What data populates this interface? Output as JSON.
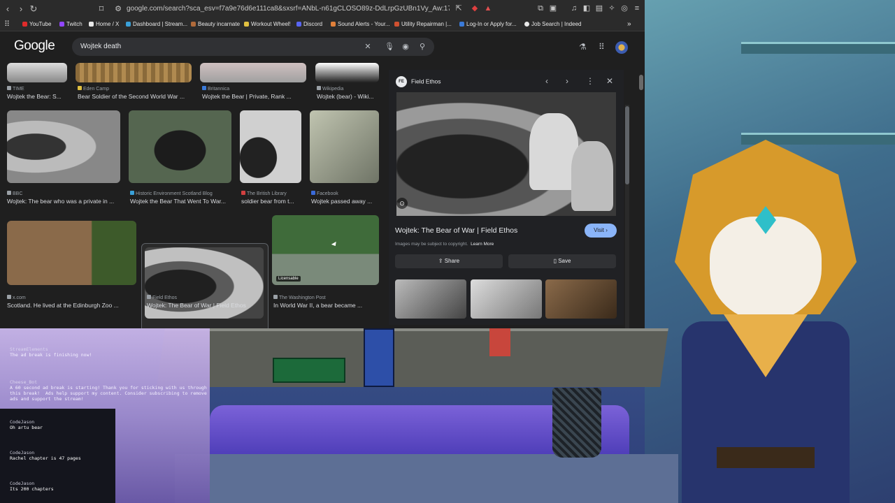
{
  "browser": {
    "url": "google.com/search?sca_esv=f7a9e76d6e111ca8&sxsrf=ANbL-n61gCLOSO89z-DdLrpGzUBn1Vy_Aw:1773295222080&udm...",
    "bookmarks": [
      {
        "label": "YouTube",
        "color": "#e02b2b"
      },
      {
        "label": "Twitch",
        "color": "#9146ff"
      },
      {
        "label": "Home / X",
        "color": "#e8e8e8"
      },
      {
        "label": "Dashboard | Stream...",
        "color": "#3aa0d8"
      },
      {
        "label": "Beauty incarnate",
        "color": "#b06a3a"
      },
      {
        "label": "Workout Wheel!",
        "color": "#e0c040"
      },
      {
        "label": "Discord",
        "color": "#5865f2"
      },
      {
        "label": "Sound Alerts - Your...",
        "color": "#e0803a"
      },
      {
        "label": "Utility Repairman |...",
        "color": "#d05030"
      },
      {
        "label": "Log-In or Apply for...",
        "color": "#3a7ad8"
      },
      {
        "label": "Job Search | Indeed",
        "color": "#e8e8e8"
      }
    ]
  },
  "google": {
    "logo": "Google",
    "query": "Wojtek death"
  },
  "results": {
    "row1": [
      {
        "source": "TIME",
        "title": "Wojtek the Bear: S..."
      },
      {
        "source": "Eden Camp",
        "title": "Bear Soldier of the Second World War ..."
      },
      {
        "source": "Britannica",
        "title": "Wojtek the Bear | Private, Rank ..."
      },
      {
        "source": "Wikipedia",
        "title": "Wojtek (bear) - Wiki..."
      }
    ],
    "row2": [
      {
        "source": "BBC",
        "title": "Wojtek: The bear who was a private in ..."
      },
      {
        "source": "Historic Environment Scotland Blog",
        "title": "Wojtek the Bear That Went To War..."
      },
      {
        "source": "The British Library",
        "title": "soldier bear from t..."
      },
      {
        "source": "Facebook",
        "title": "Wojtek passed away ..."
      }
    ],
    "row3": [
      {
        "source": "x.com",
        "title": "Scotland. He lived at the Edinburgh Zoo ..."
      },
      {
        "source": "Field Ethos",
        "title": "Wojtek: The Bear of War | Field Ethos"
      },
      {
        "source": "The Washington Post",
        "title": "In World War II, a bear became ..."
      }
    ],
    "licensable": "Licensable"
  },
  "panel": {
    "site": "Field Ethos",
    "badge": "FE",
    "title": "Wojtek: The Bear of War | Field Ethos",
    "visit": "Visit",
    "copyright": "Images may be subject to copyright.",
    "learn_more": "Learn More",
    "share": "Share",
    "save": "Save"
  },
  "chat": [
    {
      "user": "StreamElements",
      "text": "The ad break is finishing now!",
      "bot": true
    },
    {
      "user": "Cheese_Bot",
      "text": "A 60 second ad break is starting! Thank you for sticking with us through\nthis break!  Ads help support my content. Consider subscribing to remove\nads and support the stream!",
      "bot": true
    },
    {
      "user": "CodeJason",
      "text": "Oh artu bear",
      "bot": false
    },
    {
      "user": "CodeJason",
      "text": "Rachel chapter is 47 pages",
      "bot": false
    },
    {
      "user": "CodeJason",
      "text": "Its 200 chapters",
      "bot": false
    }
  ],
  "icons": {
    "back": "back-arrow-icon",
    "forward": "forward-arrow-icon",
    "reload": "reload-icon",
    "clear": "close-icon",
    "voice": "microphone-icon",
    "lens": "camera-lens-icon",
    "search": "search-icon",
    "labs": "flask-icon",
    "apps": "grid-icon"
  }
}
